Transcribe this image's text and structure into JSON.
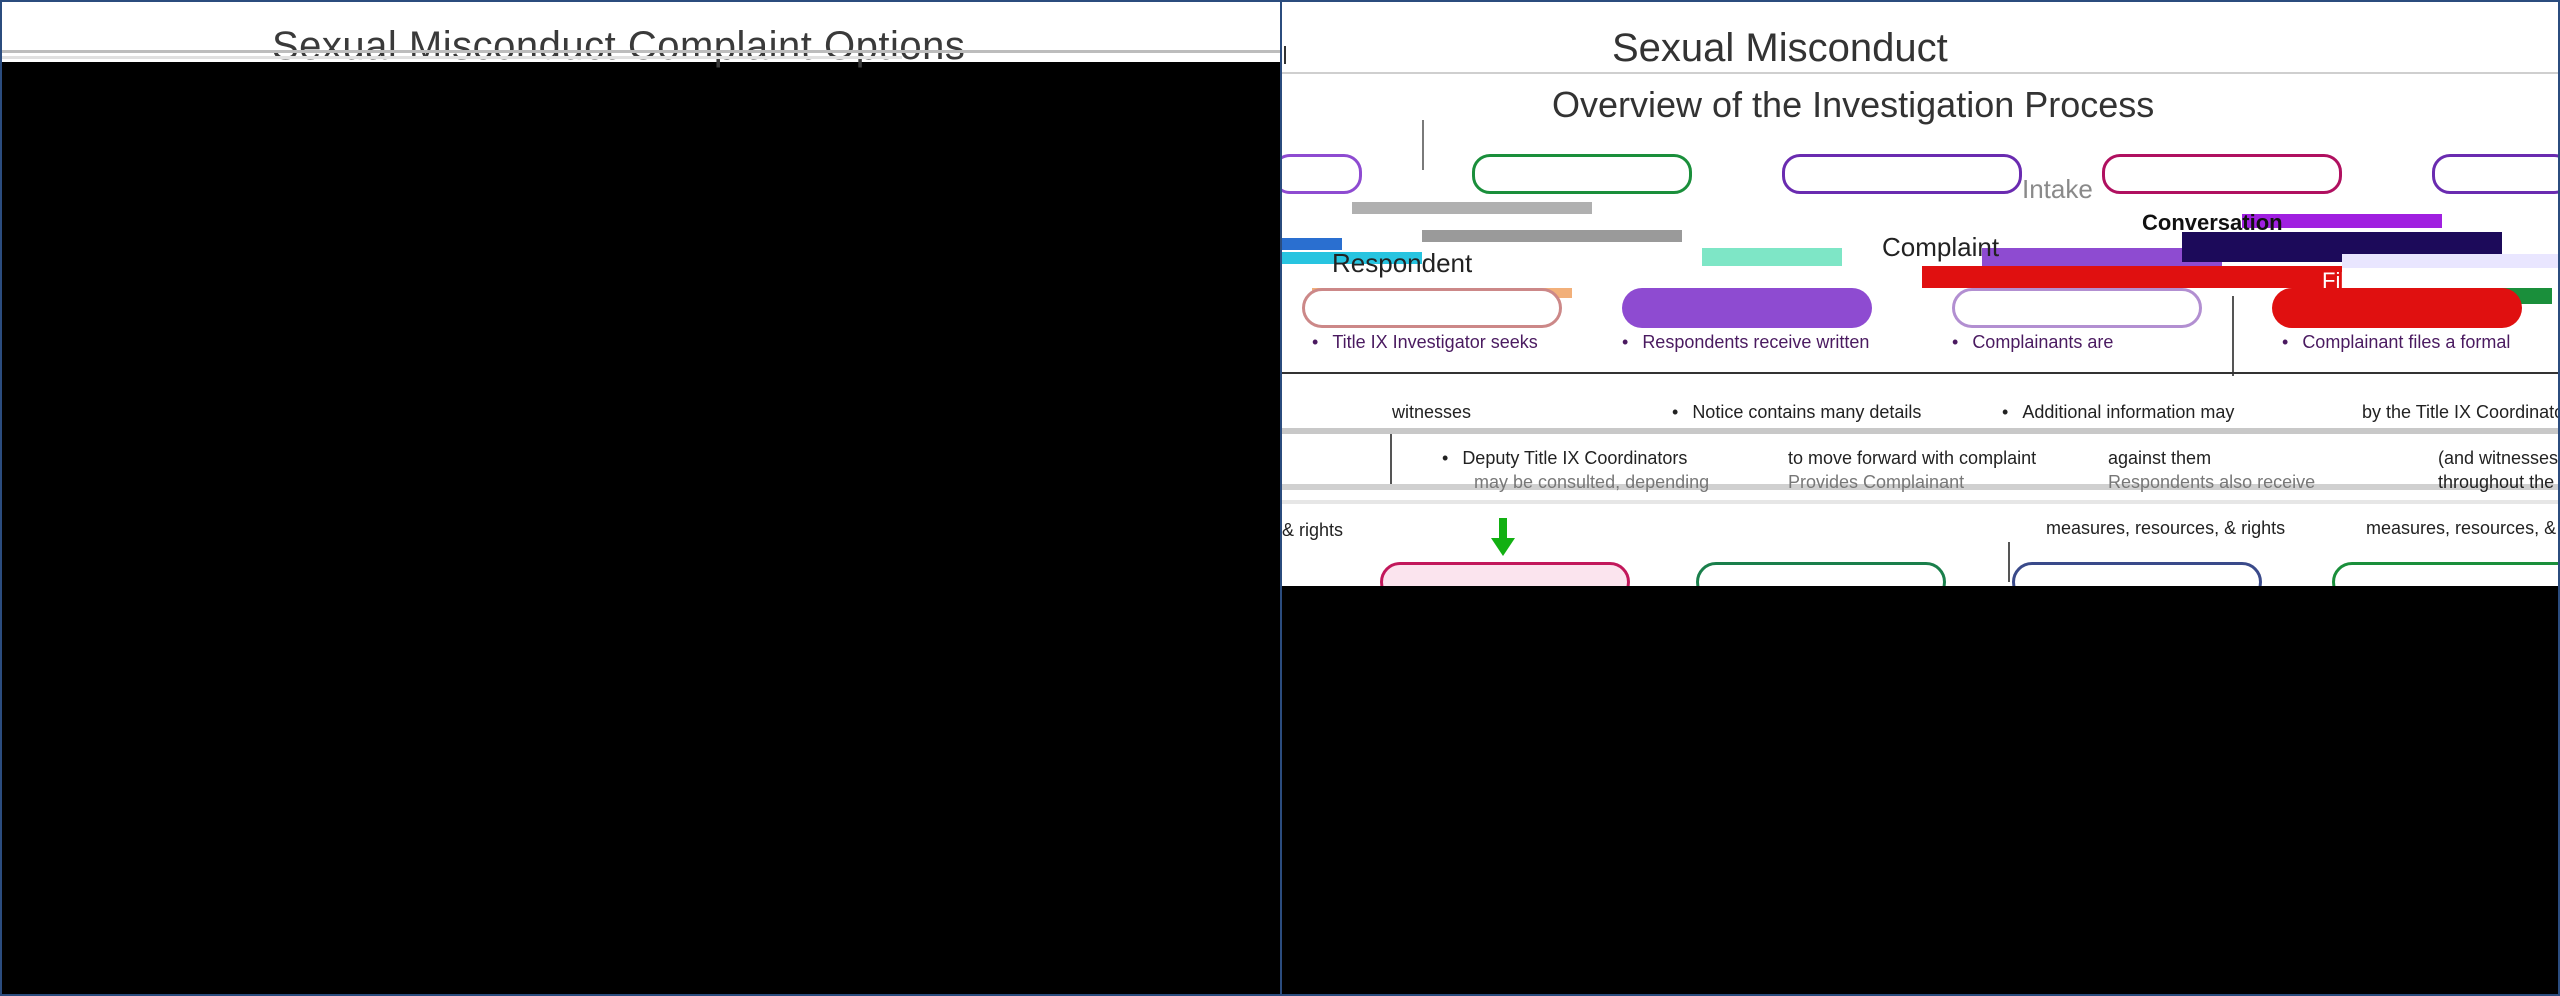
{
  "left_slide": {
    "title": "Sexual Misconduct Complaint Options"
  },
  "right_slide": {
    "title": "Sexual Misconduct",
    "subtitle": "Overview of the Investigation Process",
    "steps": [
      {
        "label": "Respondent",
        "color": "#8e4bd1"
      },
      {
        "label": "Complaint",
        "color": "#7a7a7a"
      },
      {
        "label": "Intake",
        "color": "#a9a9a9"
      },
      {
        "label": "Conversation",
        "color": "#6a2bb0"
      },
      {
        "label": "Files",
        "color": "#e01010"
      }
    ],
    "columns": [
      {
        "bullets": [
          "Title IX Investigator seeks",
          "witnesses"
        ]
      },
      {
        "bullets": [
          "Respondents receive written",
          "Notice contains many details"
        ]
      },
      {
        "bullets": [
          "Complainants are",
          "Additional information may"
        ]
      },
      {
        "bullets": [
          "Complainant files a formal",
          "by the Title IX Coordinator"
        ]
      }
    ],
    "mid_text": {
      "deputy_bullet": "Deputy Title IX Coordinators",
      "may_be": "may be consulted, depending",
      "move_forward": "to move forward with complaint",
      "against_them": "against them",
      "provides": "Provides Complainant",
      "respondents_also": "Respondents also receive",
      "measures_left": "& rights",
      "measures_a": "measures, resources, & rights",
      "measures_b": "measures, resources, &",
      "witnesses_right": "(and witnesses",
      "throughout": "throughout the"
    },
    "bottom_pills": [
      {
        "color": "#c2185b"
      },
      {
        "color": "#1a7f4b"
      },
      {
        "color": "#3a4a8a"
      },
      {
        "color": "#1a8f3b"
      }
    ]
  }
}
